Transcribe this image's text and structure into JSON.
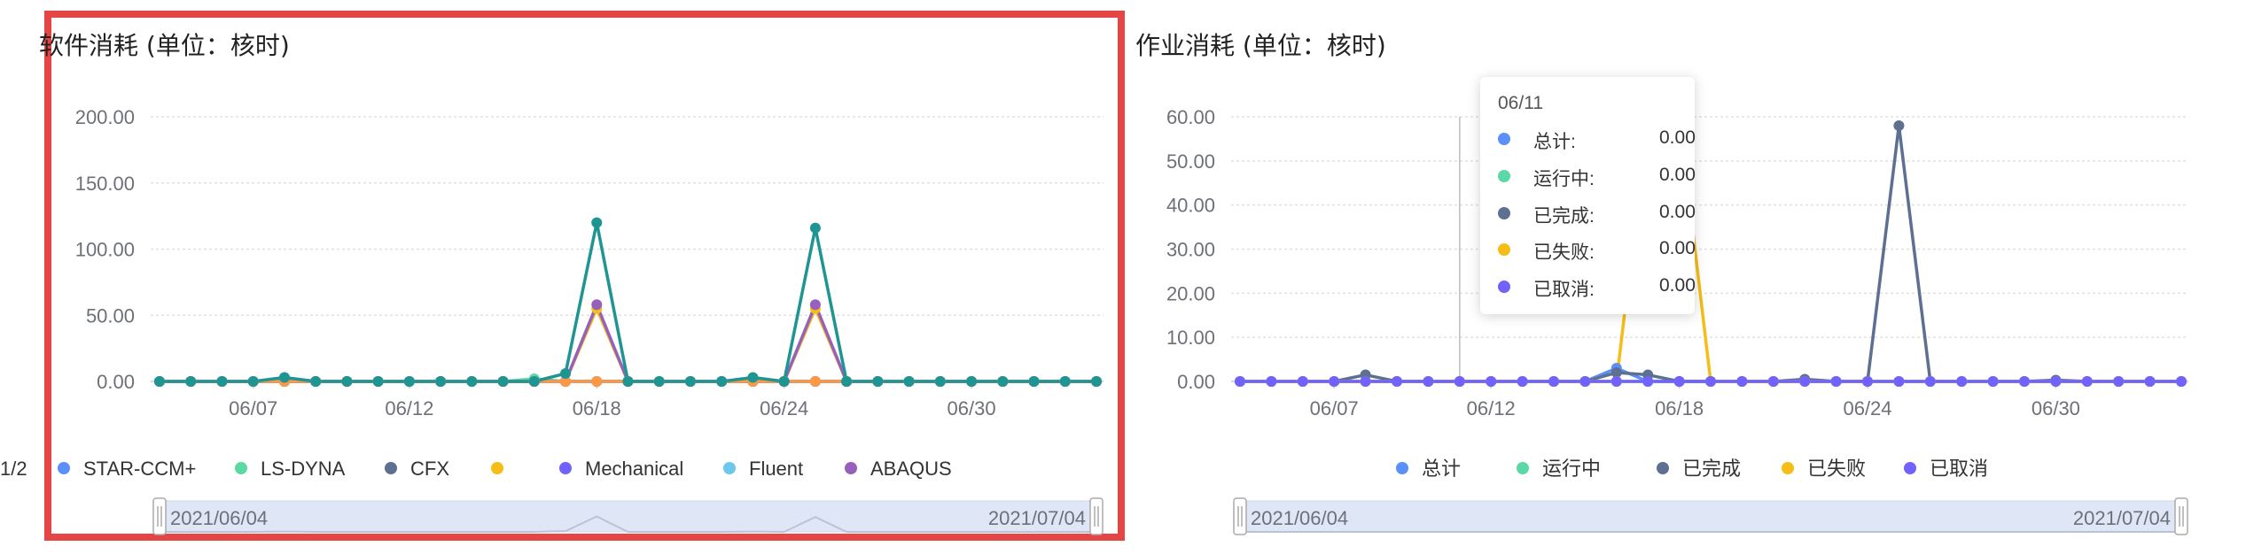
{
  "colors": {
    "blue": "#5b8ff9",
    "green": "#5ad8a6",
    "slate": "#5d7092",
    "yellow": "#f6bd16",
    "purple": "#7262fd",
    "skyblue": "#6dc8ec",
    "violet": "#9661bc",
    "orange": "#ff9845",
    "teal": "#1e9493",
    "highlight": "#e64545"
  },
  "left": {
    "title": "软件消耗 (单位：核时)",
    "legend": [
      {
        "name": "STAR-CCM+",
        "color": "#5b8ff9"
      },
      {
        "name": "LS-DYNA",
        "color": "#5ad8a6"
      },
      {
        "name": "CFX",
        "color": "#5d7092"
      },
      {
        "name": "",
        "color": "#f6bd16"
      },
      {
        "name": "Mechanical",
        "color": "#7262fd"
      },
      {
        "name": "Fluent",
        "color": "#6dc8ec"
      },
      {
        "name": "ABAQUS",
        "color": "#9661bc"
      }
    ],
    "legend_page": "1/2",
    "slider": {
      "start": "2021/06/04",
      "end": "2021/07/04"
    }
  },
  "right": {
    "title": "作业消耗 (单位：核时)",
    "legend": [
      {
        "name": "总计",
        "color": "#5b8ff9"
      },
      {
        "name": "运行中",
        "color": "#5ad8a6"
      },
      {
        "name": "已完成",
        "color": "#5d7092"
      },
      {
        "name": "已失败",
        "color": "#f6bd16"
      },
      {
        "name": "已取消",
        "color": "#7262fd"
      }
    ],
    "slider": {
      "start": "2021/06/04",
      "end": "2021/07/04"
    },
    "tooltip": {
      "title": "06/11",
      "rows": [
        {
          "name": "总计:",
          "value": "0.00",
          "color": "#5b8ff9"
        },
        {
          "name": "运行中:",
          "value": "0.00",
          "color": "#5ad8a6"
        },
        {
          "name": "已完成:",
          "value": "0.00",
          "color": "#5d7092"
        },
        {
          "name": "已失败:",
          "value": "0.00",
          "color": "#f6bd16"
        },
        {
          "name": "已取消:",
          "value": "0.00",
          "color": "#7262fd"
        }
      ]
    }
  },
  "chart_data": [
    {
      "type": "line",
      "title": "软件消耗 (单位：核时)",
      "x_dates": [
        "06/04",
        "06/05",
        "06/06",
        "06/07",
        "06/08",
        "06/09",
        "06/10",
        "06/11",
        "06/12",
        "06/13",
        "06/14",
        "06/15",
        "06/16",
        "06/17",
        "06/18",
        "06/19",
        "06/20",
        "06/21",
        "06/22",
        "06/23",
        "06/24",
        "06/25",
        "06/26",
        "06/27",
        "06/28",
        "06/29",
        "06/30",
        "07/01",
        "07/02",
        "07/03",
        "07/04"
      ],
      "xticks": [
        "06/07",
        "06/12",
        "06/18",
        "06/24",
        "06/30"
      ],
      "yticks": [
        "0.00",
        "50.00",
        "100.00",
        "150.00",
        "200.00"
      ],
      "ylim": [
        0,
        200
      ],
      "grid": true,
      "series": [
        {
          "name": "STAR-CCM+",
          "color": "#5b8ff9",
          "values": [
            0,
            0,
            0,
            0,
            0,
            0,
            0,
            0,
            0,
            0,
            0,
            0,
            1,
            0,
            0,
            0,
            0,
            0,
            0,
            0,
            0,
            0,
            0,
            0,
            0,
            0,
            0,
            0,
            0,
            0,
            0
          ]
        },
        {
          "name": "LS-DYNA",
          "color": "#5ad8a6",
          "values": [
            0,
            0,
            0,
            0,
            0,
            0,
            0,
            0,
            0,
            0,
            0,
            0,
            2,
            0,
            0,
            0,
            0,
            0,
            0,
            0,
            0,
            0,
            0,
            0,
            0,
            0,
            0,
            0,
            0,
            0,
            0
          ]
        },
        {
          "name": "CFX",
          "color": "#5d7092",
          "values": [
            0,
            0,
            0,
            0,
            0,
            0,
            0,
            0,
            0,
            0,
            0,
            0,
            0,
            0,
            0,
            0,
            0,
            0,
            0,
            0,
            0,
            0,
            0,
            0,
            0,
            0,
            0,
            0,
            0,
            0,
            0
          ]
        },
        {
          "name": "",
          "color": "#f6bd16",
          "values": [
            0,
            0,
            0,
            0,
            0,
            0,
            0,
            0,
            0,
            0,
            0,
            0,
            0,
            0,
            55,
            0,
            0,
            0,
            0,
            0,
            0,
            55,
            0,
            0,
            0,
            0,
            0,
            0,
            0,
            0,
            0
          ]
        },
        {
          "name": "Mechanical",
          "color": "#7262fd",
          "values": [
            0,
            0,
            0,
            0,
            0,
            0,
            0,
            0,
            0,
            0,
            0,
            0,
            0,
            0,
            0,
            0,
            0,
            0,
            0,
            0,
            0,
            0,
            0,
            0,
            0,
            0,
            0,
            0,
            0,
            0,
            0
          ]
        },
        {
          "name": "Fluent",
          "color": "#6dc8ec",
          "values": [
            0,
            0,
            0,
            0,
            0,
            0,
            0,
            0,
            0,
            0,
            0,
            0,
            0,
            0,
            0,
            0,
            0,
            0,
            0,
            0,
            0,
            0,
            0,
            0,
            0,
            0,
            0,
            0,
            0,
            0,
            0
          ]
        },
        {
          "name": "ABAQUS",
          "color": "#9661bc",
          "values": [
            0,
            0,
            0,
            0,
            0,
            0,
            0,
            0,
            0,
            0,
            0,
            0,
            0,
            0,
            58,
            0,
            0,
            0,
            0,
            0,
            0,
            58,
            0,
            0,
            0,
            0,
            0,
            0,
            0,
            0,
            0
          ]
        },
        {
          "color": "#ff9845",
          "values": [
            0,
            0,
            0,
            0,
            0,
            0,
            0,
            0,
            0,
            0,
            0,
            0,
            0,
            0,
            0,
            0,
            0,
            0,
            0,
            0,
            0,
            0,
            0,
            0,
            0,
            0,
            0,
            0,
            0,
            0,
            0
          ]
        },
        {
          "color": "#1e9493",
          "values": [
            0,
            0,
            0,
            0,
            3,
            0,
            0,
            0,
            0,
            0,
            0,
            0,
            0,
            6,
            120,
            0,
            0,
            0,
            0,
            3,
            0,
            116,
            0,
            0,
            0,
            0,
            0,
            0,
            0,
            0,
            0
          ]
        }
      ]
    },
    {
      "type": "line",
      "title": "作业消耗 (单位：核时)",
      "x_dates": [
        "06/04",
        "06/05",
        "06/06",
        "06/07",
        "06/08",
        "06/09",
        "06/10",
        "06/11",
        "06/12",
        "06/13",
        "06/14",
        "06/15",
        "06/16",
        "06/17",
        "06/18",
        "06/19",
        "06/20",
        "06/21",
        "06/22",
        "06/23",
        "06/24",
        "06/25",
        "06/26",
        "06/27",
        "06/28",
        "06/29",
        "06/30",
        "07/01",
        "07/02",
        "07/03",
        "07/04"
      ],
      "xticks": [
        "06/07",
        "06/12",
        "06/18",
        "06/24",
        "06/30"
      ],
      "yticks": [
        "0.00",
        "10.00",
        "20.00",
        "30.00",
        "40.00",
        "50.00",
        "60.00"
      ],
      "ylim": [
        0,
        60
      ],
      "grid": true,
      "series": [
        {
          "name": "总计",
          "color": "#5b8ff9",
          "values": [
            0,
            0,
            0,
            0,
            0,
            0,
            0,
            0,
            0,
            0,
            0,
            0,
            3,
            0,
            0,
            0,
            0,
            0,
            0,
            0,
            0,
            0,
            0,
            0,
            0,
            0,
            0,
            0,
            0,
            0,
            0
          ]
        },
        {
          "name": "运行中",
          "color": "#5ad8a6",
          "values": [
            0,
            0,
            0,
            0,
            0,
            0,
            0,
            0,
            0,
            0,
            0,
            0,
            0,
            0,
            0,
            0,
            0,
            0,
            0,
            0,
            0,
            0,
            0,
            0,
            0,
            0,
            0,
            0,
            0,
            0,
            0
          ]
        },
        {
          "name": "已完成",
          "color": "#5d7092",
          "values": [
            0,
            0,
            0,
            0,
            1.5,
            0,
            0,
            0,
            0,
            0,
            0,
            0,
            2,
            1.5,
            0,
            0,
            0,
            0,
            0.5,
            0,
            0,
            58,
            0,
            0,
            0,
            0,
            0.3,
            0,
            0,
            0,
            0
          ]
        },
        {
          "name": "已失败",
          "color": "#f6bd16",
          "values": [
            0,
            0,
            0,
            0,
            0,
            0,
            0,
            0,
            0,
            0,
            0,
            0,
            0,
            60,
            60,
            0,
            0,
            0,
            0,
            0,
            0,
            0,
            0,
            0,
            0,
            0,
            0,
            0,
            0,
            0,
            0
          ]
        },
        {
          "name": "已取消",
          "color": "#7262fd",
          "values": [
            0,
            0,
            0,
            0,
            0,
            0,
            0,
            0,
            0,
            0,
            0,
            0,
            0,
            0,
            0,
            0,
            0,
            0,
            0,
            0,
            0,
            0,
            0,
            0,
            0,
            0,
            0,
            0,
            0,
            0,
            0
          ]
        }
      ]
    }
  ]
}
